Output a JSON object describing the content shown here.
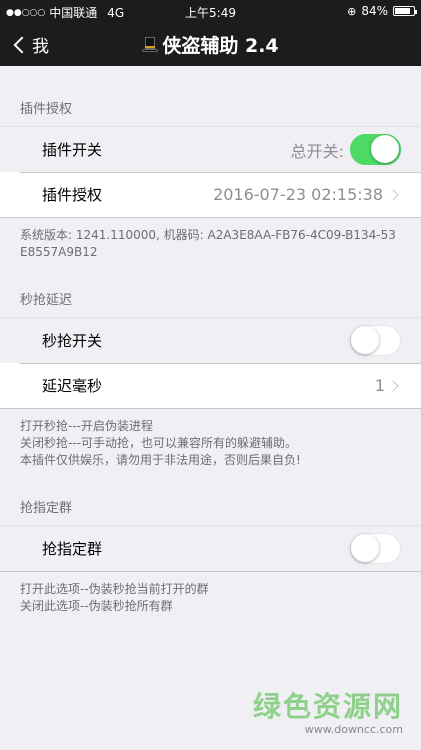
{
  "status_bar": {
    "signal_dots": "●●○○○",
    "carrier": "中国联通",
    "network": "4G",
    "time": "上午5:49",
    "lock_icon": "rotation-lock-icon",
    "battery_text": "84%",
    "battery_level": 0.84
  },
  "nav": {
    "back_label": "我",
    "title": "侠盗辅助 2.4",
    "title_icon": "top-hat-icon"
  },
  "sections": {
    "auth": {
      "header": "插件授权",
      "switch_label": "插件开关",
      "switch_caption": "总开关:",
      "switch_on": true,
      "auth_label": "插件授权",
      "auth_value": "2016-07-23 02:15:38",
      "footer": "系统版本: 1241.110000, 机器码:  A2A3E8AA-FB76-4C09-B134-53E8557A9B12"
    },
    "delay": {
      "header": "秒抢延迟",
      "switch_label": "秒抢开关",
      "switch_on": false,
      "ms_label": "延迟毫秒",
      "ms_value": "1",
      "footer_line1": "打开秒抢---开启伪装进程",
      "footer_line2": "关闭秒抢---可手动抢，也可以兼容所有的躲避辅助。",
      "footer_line3": "本插件仅供娱乐，请勿用于非法用途，否则后果自负!"
    },
    "group": {
      "header": "抢指定群",
      "switch_label": "抢指定群",
      "switch_on": false,
      "footer_line1": "打开此选项--伪装秒抢当前打开的群",
      "footer_line2": "关闭此选项--伪装秒抢所有群"
    }
  },
  "watermark": {
    "main": "绿色资源网",
    "sub": "www.downcc.com"
  },
  "colors": {
    "toggle_on": "#4cd964",
    "nav_bg": "#1c1c1e",
    "page_bg": "#efeff4",
    "watermark": "#8fd18a"
  }
}
